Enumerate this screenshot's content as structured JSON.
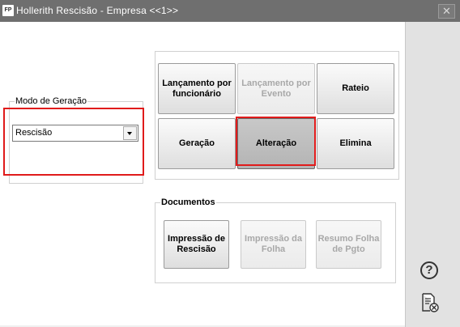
{
  "window": {
    "title": "Hollerith Rescisão - Empresa <<1>>",
    "app_badge": "FP",
    "close_glyph": "✕"
  },
  "modo_geracao": {
    "legend": "Modo de Geração",
    "selected": "Rescisão"
  },
  "actions": {
    "lancamento_funcionario": "Lançamento por funcionário",
    "lancamento_evento": "Lançamento por Evento",
    "rateio": "Rateio",
    "geracao": "Geração",
    "alteracao": "Alteração",
    "elimina": "Elimina"
  },
  "documentos": {
    "legend": "Documentos",
    "impressao_rescisao": "Impressão de Rescisão",
    "impressao_folha": "Impressão da Folha",
    "resumo_folha": "Resumo Folha de Pgto"
  },
  "side": {
    "help_glyph": "?"
  },
  "icons": {
    "help": "help-icon",
    "close_document": "document-close-icon",
    "dropdown": "chevron-down-icon"
  },
  "colors": {
    "highlight": "#e01b1b",
    "titlebar": "#6f6f6f"
  }
}
